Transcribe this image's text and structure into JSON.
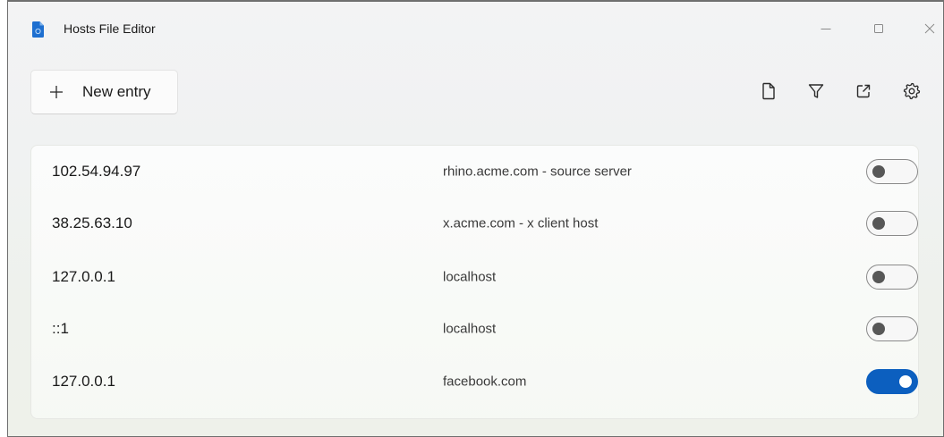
{
  "window": {
    "title": "Hosts File Editor"
  },
  "toolbar": {
    "new_entry_label": "New entry",
    "icons": [
      "new-file-icon",
      "filter-icon",
      "open-external-icon",
      "settings-gear-icon"
    ]
  },
  "caption_buttons": [
    "minimize",
    "maximize",
    "close"
  ],
  "entries": [
    {
      "ip": "102.54.94.97",
      "host": "rhino.acme.com - source server",
      "enabled": false
    },
    {
      "ip": "38.25.63.10",
      "host": "x.acme.com - x client host",
      "enabled": false
    },
    {
      "ip": "127.0.0.1",
      "host": "localhost",
      "enabled": false
    },
    {
      "ip": "::1",
      "host": "localhost",
      "enabled": false
    },
    {
      "ip": "127.0.0.1",
      "host": "facebook.com",
      "enabled": true
    }
  ],
  "colors": {
    "accent": "#0c5fbf",
    "app_icon": "#1e6fd0",
    "toggle_off_knob": "#575757",
    "text_primary": "#1a1a1a",
    "text_secondary": "#3a3a3a"
  }
}
